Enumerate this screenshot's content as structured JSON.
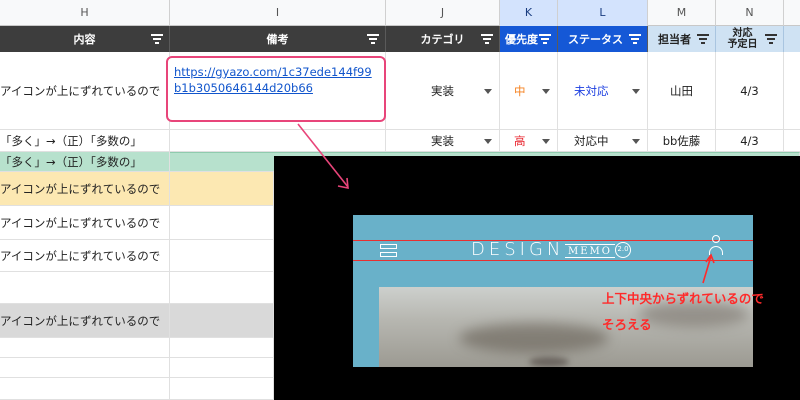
{
  "columns": [
    "H",
    "I",
    "J",
    "K",
    "L",
    "M",
    "N"
  ],
  "headers": {
    "naiyou": "内容",
    "bikou": "備考",
    "category": "カテゴリ",
    "priority": "優先度",
    "status": "ステータス",
    "assignee": "担当者",
    "due_line1": "対応",
    "due_line2": "予定日"
  },
  "rows": [
    {
      "content": "アイコンが上にずれているので",
      "note": "https://gyazo.com/1c37ede144f99b1b3050646144d20b66",
      "category": "実装",
      "priority": "中",
      "status": "未対応",
      "assignee": "山田",
      "due": "4/3"
    },
    {
      "content": "「多く」→（正）「多数の」",
      "category": "実装",
      "priority": "高",
      "status": "対応中",
      "assignee": "bb佐藤",
      "due": "4/3"
    },
    {
      "content": "「多く」→（正）「多数の」"
    },
    {
      "content": "アイコンが上にずれているので"
    },
    {
      "content": "アイコンが上にずれているので"
    },
    {
      "content": "アイコンが上にずれているので"
    },
    {
      "content": "アイコンが上にずれているので"
    }
  ],
  "overlay": {
    "logo_text": "DESIGN",
    "memo_text": "MEMO",
    "version": "2.0",
    "annotation_line1": "上下中央からずれているので",
    "annotation_line2": "そろえる"
  },
  "colors": {
    "header_dark": "#3d3d3d",
    "header_blue": "#1558d6",
    "highlight_pink": "#e8457a",
    "row_green": "#b7e1cd",
    "row_yellow": "#fce8b2",
    "row_gray": "#d9d9d9",
    "site_blue": "#69b1c9",
    "annotation_red": "#ff2a2a"
  }
}
